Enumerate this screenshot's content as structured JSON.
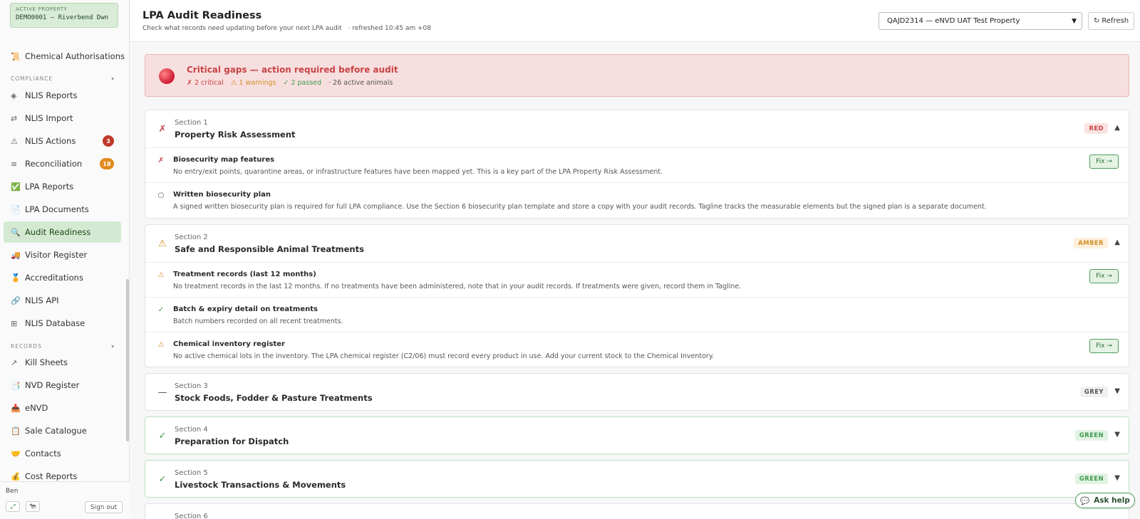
{
  "sidebar": {
    "active_property_caption": "ACTIVE PROPERTY",
    "active_property_value": "DEMO0001 — Riverbend Dwn",
    "items_top": [
      {
        "label": "Chemical Authorisations",
        "icon": "📜"
      }
    ],
    "compliance": {
      "heading": "COMPLIANCE",
      "items": [
        {
          "label": "NLIS Reports",
          "icon": "◈"
        },
        {
          "label": "NLIS Import",
          "icon": "⇄"
        },
        {
          "label": "NLIS Actions",
          "icon": "⚠",
          "badge": "3",
          "badge_color": "#c0392b"
        },
        {
          "label": "Reconciliation",
          "icon": "≡",
          "badge": "18",
          "badge_color": "#e08a1e"
        },
        {
          "label": "LPA Reports",
          "icon": "✅"
        },
        {
          "label": "LPA Documents",
          "icon": "📄"
        },
        {
          "label": "Audit Readiness",
          "icon": "🔍",
          "active": true
        },
        {
          "label": "Visitor Register",
          "icon": "🚚"
        },
        {
          "label": "Accreditations",
          "icon": "🏅"
        },
        {
          "label": "NLIS API",
          "icon": "🔗"
        },
        {
          "label": "NLIS Database",
          "icon": "⊞"
        }
      ]
    },
    "records": {
      "heading": "RECORDS",
      "items": [
        {
          "label": "Kill Sheets",
          "icon": "↗"
        },
        {
          "label": "NVD Register",
          "icon": "📑"
        },
        {
          "label": "eNVD",
          "icon": "📥"
        },
        {
          "label": "Sale Catalogue",
          "icon": "📋"
        },
        {
          "label": "Contacts",
          "icon": "🤝"
        },
        {
          "label": "Cost Reports",
          "icon": "💰"
        }
      ]
    },
    "section_chevron": "▾",
    "user_name": "Ben",
    "footer_btn_1": "⤢",
    "footer_btn_2": "🐄",
    "sign_out_label": "Sign out"
  },
  "header": {
    "title": "LPA Audit Readiness",
    "subtitle": "Check what records need updating before your next LPA audit",
    "refreshed": "· refreshed 10:45 am +08",
    "property_select": "QAJD2314 — eNVD UAT Test Property",
    "refresh_label": "↻ Refresh"
  },
  "alert": {
    "title": "Critical gaps — action required before audit",
    "critical": "✗ 2 critical",
    "warnings": "⚠ 1 warnings",
    "passed": "✓ 2 passed",
    "animals": "· 26 active animals"
  },
  "sections": [
    {
      "num": "Section 1",
      "title": "Property Risk Assessment",
      "status": "RED",
      "status_icon": "✗",
      "chevron": "▲",
      "items": [
        {
          "icon": "✗",
          "title": "Biosecurity map features",
          "desc": "No entry/exit points, quarantine areas, or infrastructure features have been mapped yet. This is a key part of the LPA Property Risk Assessment.",
          "fix": "Fix →"
        },
        {
          "icon": "○",
          "title": "Written biosecurity plan",
          "desc": "A signed written biosecurity plan is required for full LPA compliance. Use the Section 6 biosecurity plan template and store a copy with your audit records. Tagline tracks the measurable elements but the signed plan is a separate document."
        }
      ]
    },
    {
      "num": "Section 2",
      "title": "Safe and Responsible Animal Treatments",
      "status": "AMBER",
      "status_icon": "⚠",
      "chevron": "▲",
      "items": [
        {
          "icon": "⚠",
          "title": "Treatment records (last 12 months)",
          "desc": "No treatment records in the last 12 months. If no treatments have been administered, note that in your audit records. If treatments were given, record them in Tagline.",
          "fix": "Fix →"
        },
        {
          "icon": "✓",
          "title": "Batch & expiry detail on treatments",
          "desc": "Batch numbers recorded on all recent treatments."
        },
        {
          "icon": "⚠",
          "title": "Chemical inventory register",
          "desc": "No active chemical lots in the inventory. The LPA chemical register (C2/06) must record every product in use. Add your current stock to the Chemical Inventory.",
          "fix": "Fix →"
        }
      ]
    },
    {
      "num": "Section 3",
      "title": "Stock Foods, Fodder & Pasture Treatments",
      "status": "GREY",
      "status_icon": "—",
      "chevron": "▼"
    },
    {
      "num": "Section 4",
      "title": "Preparation for Dispatch",
      "status": "GREEN",
      "status_icon": "✓",
      "chevron": "▼"
    },
    {
      "num": "Section 5",
      "title": "Livestock Transactions & Movements",
      "status": "GREEN",
      "status_icon": "✓",
      "chevron": "▼"
    },
    {
      "num": "Section 6"
    }
  ],
  "colors": {
    "red": "#c74444",
    "amber": "#d09028",
    "green": "#3f9a4f",
    "grey": "#555555",
    "accent": "#d4e9d2"
  },
  "ask_help": {
    "icon": "💬",
    "label": "Ask help"
  }
}
